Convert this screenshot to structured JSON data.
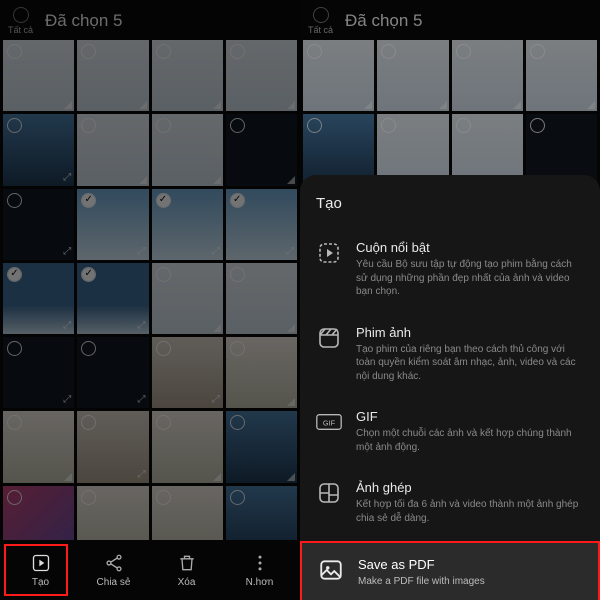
{
  "left": {
    "all_label": "Tất cả",
    "title": "Đã chọn 5",
    "bottom": [
      {
        "label": "Tạo",
        "icon": "create-icon"
      },
      {
        "label": "Chia sẻ",
        "icon": "share-icon"
      },
      {
        "label": "Xóa",
        "icon": "trash-icon"
      },
      {
        "label": "N.hơn",
        "icon": "more-icon"
      }
    ]
  },
  "right": {
    "all_label": "Tất cả",
    "title": "Đã chọn 5",
    "sheet_title": "Tạo",
    "options": [
      {
        "title": "Cuộn nổi bật",
        "sub": "Yêu cầu Bộ sưu tập tự động tạo phim bằng cách sử dụng những phần đẹp nhất của ảnh và video bạn chọn."
      },
      {
        "title": "Phim ảnh",
        "sub": "Tạo phim của riêng bạn theo cách thủ công với toàn quyền kiểm soát âm nhạc, ảnh, video và các nội dung khác."
      },
      {
        "title": "GIF",
        "sub": "Chọn một chuỗi các ảnh và kết hợp chúng thành một ảnh động."
      },
      {
        "title": "Ảnh ghép",
        "sub": "Kết hợp tối đa 6 ảnh và video thành một ảnh ghép chia sẻ dễ dàng."
      },
      {
        "title": "Save as PDF",
        "sub": "Make a PDF file with images"
      }
    ]
  }
}
